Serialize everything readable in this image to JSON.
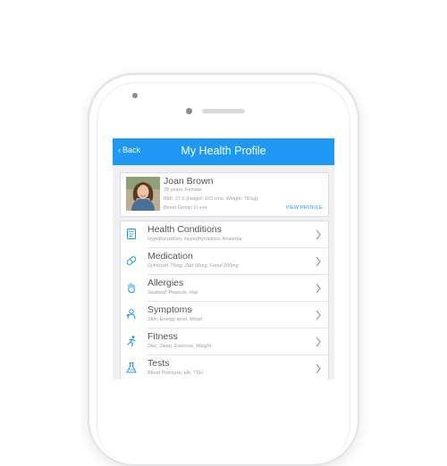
{
  "header": {
    "back_label": "Back",
    "title": "My Health Profile"
  },
  "profile": {
    "name": "Joan Brown",
    "age_gender": "28 years, Female",
    "bmi": "BMI: 27.5 (Height: 163 cms, Weight: 78 kg)",
    "blood_group": "Blood Group: O +ve",
    "view_profile_label": "VIEW PROFILE"
  },
  "menu": {
    "items": [
      {
        "title": "Health Conditions",
        "subtitle": "Hypothyroidism, Hyperthyroidism, Anaemia",
        "icon": "health-conditions-icon"
      },
      {
        "title": "Medication",
        "subtitle": "Dythroxin 75mg, Zart 50mg, Fenol 200mg",
        "icon": "pill-icon"
      },
      {
        "title": "Allergies",
        "subtitle": "Seafood, Peanuts, Hay",
        "icon": "hand-icon"
      },
      {
        "title": "Symptoms",
        "subtitle": "Skin, Energy level, Mood",
        "icon": "symptoms-icon"
      },
      {
        "title": "Fitness",
        "subtitle": "Diet, Sleep, Exercise, Weight",
        "icon": "running-icon"
      },
      {
        "title": "Tests",
        "subtitle": "Blood Pressure, Hb, TSH",
        "icon": "flask-icon"
      }
    ]
  },
  "colors": {
    "accent": "#1e98f3",
    "device_frame": "#e3e3e6",
    "screen_bg": "#f0f0f2"
  }
}
